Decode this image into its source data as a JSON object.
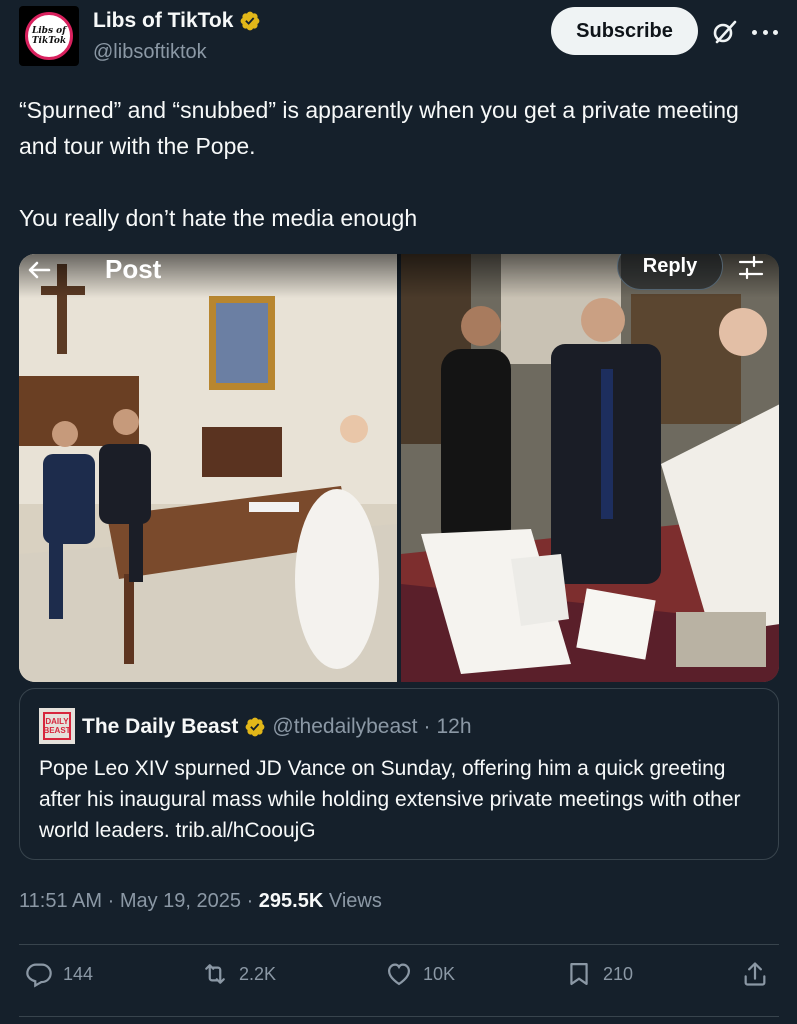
{
  "author": {
    "name": "Libs of TikTok",
    "handle": "@libsoftiktok",
    "avatar_text": "Libs of TikTok"
  },
  "header": {
    "subscribe_label": "Subscribe"
  },
  "tweet": {
    "paragraphs": [
      "“Spurned” and “snubbed” is apparently when you get a private meeting and tour with the Pope.",
      "You really don’t hate the media enough"
    ]
  },
  "media_viewer": {
    "title": "Post",
    "reply_label": "Reply"
  },
  "quote": {
    "logo_text": "DAILY BEAST",
    "name": "The Daily Beast",
    "handle": "@thedailybeast",
    "time": "12h",
    "text": "Pope Leo XIV spurned JD Vance on Sunday, offering him a quick greeting after his inaugural mass while holding extensive private meetings with other world leaders. trib.al/hCooujG"
  },
  "meta": {
    "time": "11:51 AM",
    "date": "May 19, 2025",
    "views_count": "295.5K",
    "views_label": "Views"
  },
  "actions": {
    "replies": "144",
    "reposts": "2.2K",
    "likes": "10K",
    "bookmarks": "210"
  },
  "colors": {
    "background": "#15202b",
    "verified": "#e2b719",
    "muted_text": "#8b98a5",
    "border": "#38444d"
  }
}
